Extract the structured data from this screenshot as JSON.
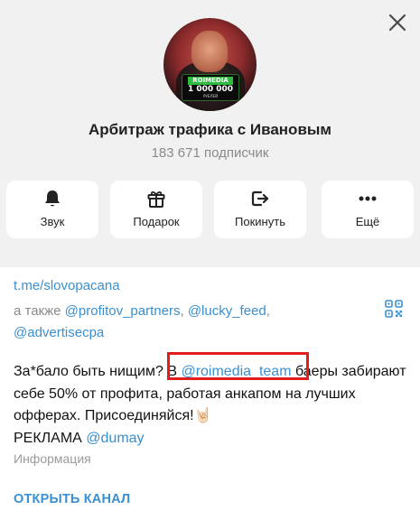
{
  "close_icon": "close-icon",
  "avatar": {
    "brand": "ROIMEDIA",
    "amount": "1 000 000",
    "currency": "РУБЛЕЙ"
  },
  "channel": {
    "title": "Арбитраж трафика с Ивановым",
    "subscribers": "183 671 подписчик"
  },
  "actions": [
    {
      "label": "Звук",
      "icon": "bell-icon"
    },
    {
      "label": "Подарок",
      "icon": "gift-icon"
    },
    {
      "label": "Покинуть",
      "icon": "leave-icon"
    },
    {
      "label": "Ещё",
      "icon": "more-dots-icon"
    }
  ],
  "info": {
    "main_link": "t.me/slovopacana",
    "also_prefix": "а также ",
    "also_links": [
      "@profitov_partners",
      "@lucky_feed",
      "@advertisecpa"
    ],
    "separator": ", ",
    "qr_icon": "qr-code-icon",
    "description": {
      "part1": "За*бало быть нищим? В ",
      "mention": "@roimedia_team",
      "part2": " баеры забирают себе 50% от профита, работая анкапом на лучших офферах. Присоединяйся!",
      "emoji": "🤘🏻",
      "ad_label": "РЕКЛАМА ",
      "ad_mention": "@dumay"
    },
    "info_label": "Информация",
    "open_channel": "ОТКРЫТЬ КАНАЛ"
  },
  "colors": {
    "background": "#f1f1f1",
    "card": "#ffffff",
    "accent": "#3a8fd0",
    "highlight": "#e11d1d",
    "muted": "#8a8a8a"
  }
}
